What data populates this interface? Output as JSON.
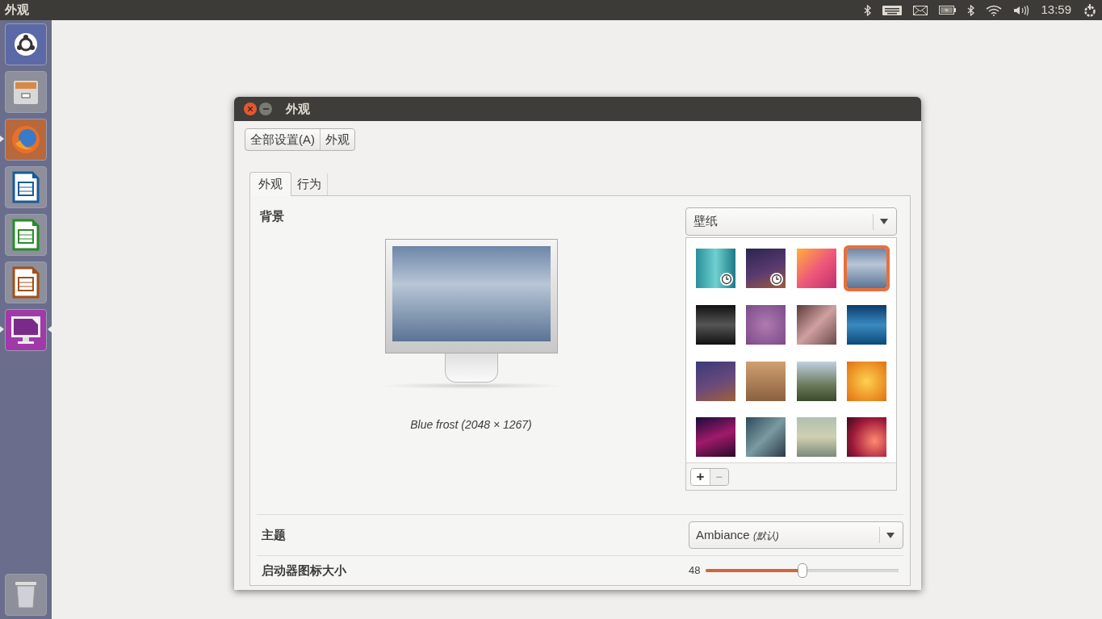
{
  "top_bar": {
    "title": "外观",
    "clock": "13:59"
  },
  "launcher": [
    {
      "kind": "dash",
      "running": false,
      "focused": false
    },
    {
      "kind": "files",
      "running": false,
      "focused": false
    },
    {
      "kind": "browser",
      "running": true,
      "focused": false
    },
    {
      "kind": "writer",
      "running": false,
      "focused": false
    },
    {
      "kind": "calc",
      "running": false,
      "focused": false
    },
    {
      "kind": "impress",
      "running": false,
      "focused": false
    },
    {
      "kind": "appearance",
      "running": true,
      "focused": true
    }
  ],
  "window": {
    "title": "外观",
    "breadcrumb": [
      "全部设置(A)",
      "外观"
    ],
    "tabs": [
      {
        "label": "外观",
        "selected": true
      },
      {
        "label": "行为",
        "selected": false
      }
    ],
    "background": {
      "label": "背景",
      "source": "壁纸",
      "caption": "Blue frost (2048 × 1267)",
      "wallpapers": [
        {
          "selected": false,
          "slideshow": true
        },
        {
          "selected": false,
          "slideshow": true
        },
        {
          "selected": false,
          "slideshow": false
        },
        {
          "selected": true,
          "slideshow": false
        },
        {
          "selected": false,
          "slideshow": false
        },
        {
          "selected": false,
          "slideshow": false
        },
        {
          "selected": false,
          "slideshow": false
        },
        {
          "selected": false,
          "slideshow": false
        },
        {
          "selected": false,
          "slideshow": false
        },
        {
          "selected": false,
          "slideshow": false
        },
        {
          "selected": false,
          "slideshow": false
        },
        {
          "selected": false,
          "slideshow": false
        },
        {
          "selected": false,
          "slideshow": false
        },
        {
          "selected": false,
          "slideshow": false
        },
        {
          "selected": false,
          "slideshow": false
        },
        {
          "selected": false,
          "slideshow": false
        }
      ],
      "add_label": "+",
      "remove_label": "−"
    },
    "theme": {
      "label": "主题",
      "value": "Ambiance",
      "note": "(默认)"
    },
    "icon_size": {
      "label": "启动器图标大小",
      "reading": "48",
      "level": 0.5
    }
  }
}
